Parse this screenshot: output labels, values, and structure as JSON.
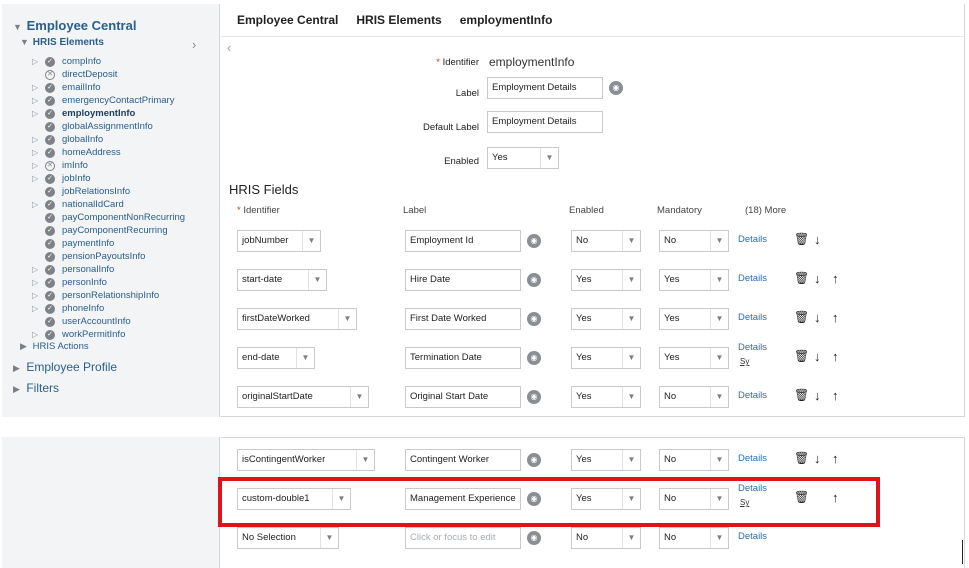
{
  "sidebar": {
    "root": "Employee Central",
    "hris_elements": "HRIS Elements",
    "items": [
      {
        "label": "compInfo",
        "status": "ok",
        "expandable": true
      },
      {
        "label": "directDeposit",
        "status": "x",
        "expandable": false
      },
      {
        "label": "emailInfo",
        "status": "ok",
        "expandable": true
      },
      {
        "label": "emergencyContactPrimary",
        "status": "ok",
        "expandable": true
      },
      {
        "label": "employmentInfo",
        "status": "ok",
        "expandable": true,
        "selected": true
      },
      {
        "label": "globalAssignmentInfo",
        "status": "ok",
        "expandable": false
      },
      {
        "label": "globalInfo",
        "status": "ok",
        "expandable": true
      },
      {
        "label": "homeAddress",
        "status": "ok",
        "expandable": true
      },
      {
        "label": "imInfo",
        "status": "x",
        "expandable": true
      },
      {
        "label": "jobInfo",
        "status": "ok",
        "expandable": true
      },
      {
        "label": "jobRelationsInfo",
        "status": "ok",
        "expandable": false
      },
      {
        "label": "nationalIdCard",
        "status": "ok",
        "expandable": true
      },
      {
        "label": "payComponentNonRecurring",
        "status": "ok",
        "expandable": false
      },
      {
        "label": "payComponentRecurring",
        "status": "ok",
        "expandable": false
      },
      {
        "label": "paymentInfo",
        "status": "ok",
        "expandable": false
      },
      {
        "label": "pensionPayoutsInfo",
        "status": "ok",
        "expandable": false
      },
      {
        "label": "personalInfo",
        "status": "ok",
        "expandable": true
      },
      {
        "label": "personInfo",
        "status": "ok",
        "expandable": true
      },
      {
        "label": "personRelationshipInfo",
        "status": "ok",
        "expandable": true
      },
      {
        "label": "phoneInfo",
        "status": "ok",
        "expandable": true
      },
      {
        "label": "userAccountInfo",
        "status": "ok",
        "expandable": false
      },
      {
        "label": "workPermitInfo",
        "status": "ok",
        "expandable": true
      }
    ],
    "hris_actions": "HRIS Actions",
    "employee_profile": "Employee Profile",
    "filters": "Filters"
  },
  "breadcrumb": [
    "Employee Central",
    "HRIS Elements",
    "employmentInfo"
  ],
  "form": {
    "identifier_label": "Identifier",
    "identifier_value": "employmentInfo",
    "label_label": "Label",
    "label_value": "Employment Details",
    "default_label_label": "Default Label",
    "default_label_value": "Employment Details",
    "enabled_label": "Enabled",
    "enabled_value": "Yes"
  },
  "hris_fields": {
    "title": "HRIS Fields",
    "headers": {
      "identifier": "Identifier",
      "label": "Label",
      "enabled": "Enabled",
      "mandatory": "Mandatory",
      "more": "(18) More"
    },
    "details_label": "Details",
    "sy_label": "Sy",
    "placeholder_label": "Click or focus to edit",
    "rows": [
      {
        "identifier": "jobNumber",
        "label": "Employment Id",
        "enabled": "No",
        "mandatory": "No",
        "sy": false,
        "down": true,
        "up": false
      },
      {
        "identifier": "start-date",
        "label": "Hire Date",
        "enabled": "Yes",
        "mandatory": "Yes",
        "sy": false,
        "down": true,
        "up": true
      },
      {
        "identifier": "firstDateWorked",
        "label": "First Date Worked",
        "enabled": "Yes",
        "mandatory": "Yes",
        "sy": false,
        "down": true,
        "up": true
      },
      {
        "identifier": "end-date",
        "label": "Termination Date",
        "enabled": "Yes",
        "mandatory": "Yes",
        "sy": true,
        "down": true,
        "up": true
      },
      {
        "identifier": "originalStartDate",
        "label": "Original Start Date",
        "enabled": "Yes",
        "mandatory": "No",
        "sy": false,
        "down": true,
        "up": true
      },
      {
        "identifier": "isContingentWorker",
        "label": "Contingent Worker",
        "enabled": "Yes",
        "mandatory": "No",
        "sy": false,
        "down": true,
        "up": true
      },
      {
        "identifier": "custom-double1",
        "label": "Management Experience",
        "enabled": "Yes",
        "mandatory": "No",
        "sy": true,
        "down": false,
        "up": true
      },
      {
        "identifier": "No Selection",
        "label": "",
        "enabled": "No",
        "mandatory": "No",
        "sy": false,
        "down": false,
        "up": false,
        "placeholder": true
      }
    ]
  },
  "colors": {
    "accent": "#2a6fb0",
    "highlight": "#e0131d",
    "sidebar_bg": "#f3f4f6"
  }
}
